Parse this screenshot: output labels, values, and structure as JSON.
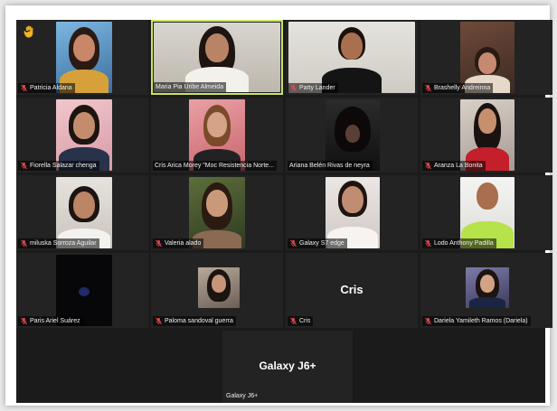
{
  "window": {
    "title": ""
  },
  "gallery": {
    "active_speaker": "Maria Pia Uribe Almeida",
    "raised_hand_icon": "raised-hand-icon",
    "muted_icon": "mic-muted-icon",
    "colors": {
      "active_border": "#c9e265",
      "muted_mic": "#e5484d",
      "tile_bg": "#232323"
    }
  },
  "participants": [
    {
      "name": "Patricia Aldana"
    },
    {
      "name": "Maria Pia Uribe Almeida"
    },
    {
      "name": "Patty Lander"
    },
    {
      "name": "Brashelly Andreinna"
    },
    {
      "name": "Fiorella Salazar chenga"
    },
    {
      "name": "Cris Arica Morey \"Moc Resistencia Norte..."
    },
    {
      "name": "Ariana Belén Rivas de neyra"
    },
    {
      "name": "Aranza La Bonita"
    },
    {
      "name": "miluska Sorroza Aguilar"
    },
    {
      "name": "Valeria alado"
    },
    {
      "name": "Galaxy S7 edge"
    },
    {
      "name": "Lodo Anthony Padilla"
    },
    {
      "name": "Paris Ariel Suárez"
    },
    {
      "name": "Paloma sandoval guerra"
    },
    {
      "name": "Cris",
      "display_text": "Cris"
    },
    {
      "name": "Dariela Yamileth Ramos (Dariela)"
    },
    {
      "name": "Galaxy J6+",
      "display_text": "Galaxy J6+"
    }
  ]
}
